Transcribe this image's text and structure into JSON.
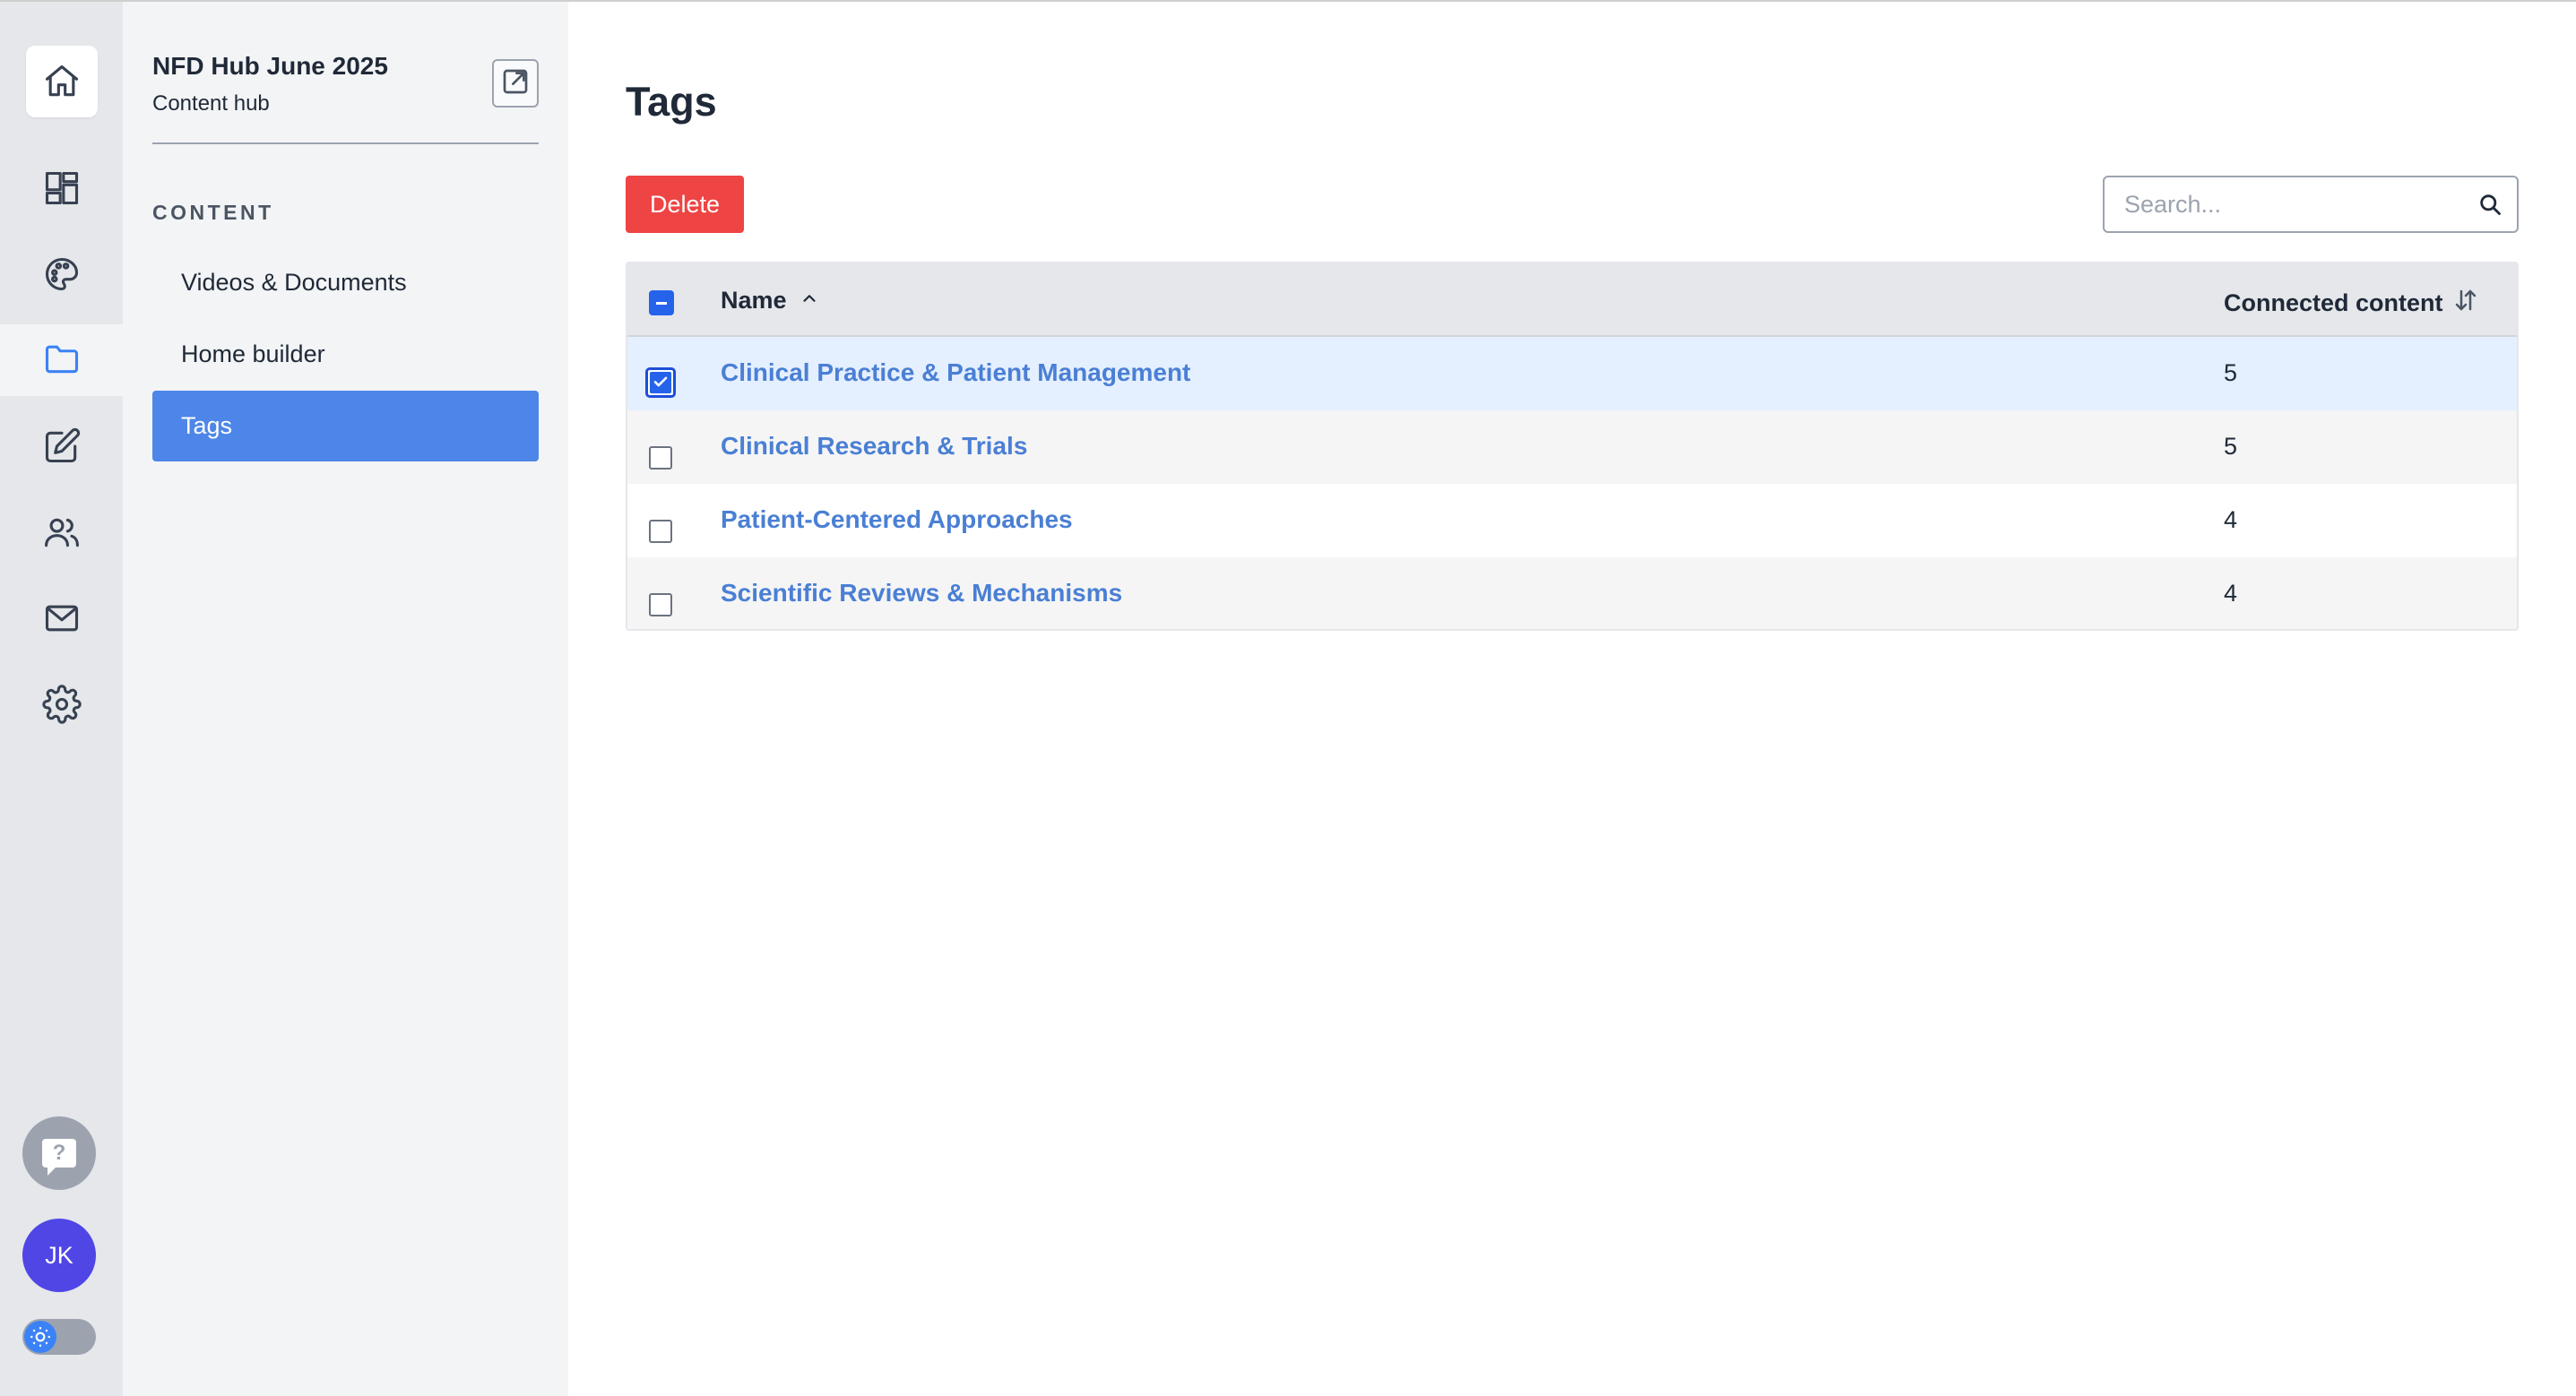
{
  "hub": {
    "title": "NFD Hub June 2025",
    "subtitle": "Content hub"
  },
  "rail": {
    "icons": [
      "home-icon",
      "dashboard-icon",
      "palette-icon",
      "folder-icon",
      "edit-icon",
      "users-icon",
      "mail-icon",
      "gear-icon"
    ],
    "active": "folder-icon",
    "help_glyph": "?",
    "avatar_initials": "JK"
  },
  "sidebar": {
    "section_label": "CONTENT",
    "items": [
      {
        "label": "Videos & Documents",
        "active": false
      },
      {
        "label": "Home builder",
        "active": false
      },
      {
        "label": "Tags",
        "active": true
      }
    ]
  },
  "main": {
    "title": "Tags",
    "delete_label": "Delete",
    "search_placeholder": "Search...",
    "table": {
      "columns": {
        "name": "Name",
        "count": "Connected content"
      },
      "rows": [
        {
          "name": "Clinical Practice & Patient Management",
          "count": "5",
          "selected": true
        },
        {
          "name": "Clinical Research & Trials",
          "count": "5",
          "selected": false
        },
        {
          "name": "Patient-Centered Approaches",
          "count": "4",
          "selected": false
        },
        {
          "name": "Scientific Reviews & Mechanisms",
          "count": "4",
          "selected": false
        }
      ]
    }
  },
  "colors": {
    "accent": "#4d86e8",
    "delete": "#ef4444",
    "link": "#4a7fd4",
    "avatar": "#4f46e5"
  }
}
